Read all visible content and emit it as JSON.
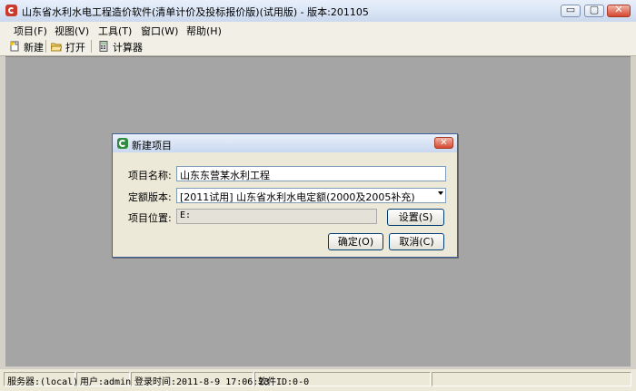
{
  "window": {
    "title": "山东省水利水电工程造价软件(清单计价及投标报价版)(试用版) - 版本:201105",
    "minimize_glyph": "▭",
    "maximize_glyph": "▢",
    "close_glyph": "✕"
  },
  "menu": {
    "items": [
      "项目(F)",
      "视图(V)",
      "工具(T)",
      "窗口(W)",
      "帮助(H)"
    ]
  },
  "toolbar": {
    "new_label": "新建",
    "open_label": "打开",
    "calc_label": "计算器"
  },
  "dialog": {
    "title": "新建项目",
    "close_glyph": "✕",
    "name_label": "项目名称:",
    "name_value": "山东东营某水利工程",
    "quota_label": "定额版本:",
    "quota_value": "[2011试用] 山东省水利水电定额(2000及2005补充)",
    "location_label": "项目位置:",
    "location_value": "E:",
    "settings_button": "设置(S)",
    "ok_button": "确定(O)",
    "cancel_button": "取消(C)"
  },
  "status": {
    "server": "服务器:(local)",
    "user": "用户:admin",
    "login_time": "登录时间:2011-8-9 17:06:23",
    "software_id": "软件ID:0-0"
  }
}
